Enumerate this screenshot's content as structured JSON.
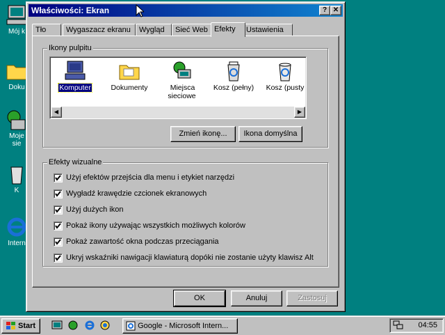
{
  "desktop": {
    "icons": [
      {
        "label": "Mój k",
        "icon": "computer-icon"
      },
      {
        "label": "Doku",
        "icon": "folder-icon"
      },
      {
        "label": "Moje",
        "label2": "sie",
        "icon": "network-icon"
      },
      {
        "label": "K",
        "icon": "recycle-bin-icon"
      },
      {
        "label": "Intern",
        "icon": "internet-explorer-icon"
      }
    ]
  },
  "window": {
    "title": "Właściwości: Ekran",
    "help_button": "?",
    "close_button": "✕"
  },
  "tabs": [
    {
      "label": "Tło"
    },
    {
      "label": "Wygaszacz ekranu"
    },
    {
      "label": "Wygląd"
    },
    {
      "label": "Sieć Web"
    },
    {
      "label": "Efekty",
      "active": true
    },
    {
      "label": "Ustawienia"
    }
  ],
  "desktop_icons_group": {
    "legend": "Ikony pulpitu",
    "items": [
      {
        "label": "Komputer",
        "icon": "computer-icon",
        "selected": true
      },
      {
        "label": "Dokumenty",
        "icon": "folder-icon"
      },
      {
        "label": "Miejsca sieciowe",
        "icon": "network-places-icon"
      },
      {
        "label": "Kosz (pełny)",
        "icon": "recycle-bin-full-icon"
      },
      {
        "label": "Kosz (pusty",
        "icon": "recycle-bin-empty-icon"
      }
    ],
    "change_icon_button": "Zmień ikonę...",
    "default_icon_button": "Ikona domyślna"
  },
  "visual_effects_group": {
    "legend": "Efekty wizualne",
    "options": [
      {
        "label": "Użyj efektów przejścia dla menu i etykiet narzędzi",
        "checked": true
      },
      {
        "label": "Wygładź krawędzie czcionek ekranowych",
        "checked": true
      },
      {
        "label": "Użyj dużych ikon",
        "checked": true
      },
      {
        "label": "Pokaż ikony używając wszystkich możliwych kolorów",
        "checked": true
      },
      {
        "label": "Pokaż zawartość okna podczas przeciągania",
        "checked": true
      },
      {
        "label": "Ukryj wskaźniki nawigacji klawiaturą dopóki nie zostanie użyty klawisz Alt",
        "checked": true
      }
    ]
  },
  "dialog_buttons": {
    "ok": "OK",
    "cancel": "Anuluj",
    "apply": "Zastosuj"
  },
  "taskbar": {
    "start_label": "Start",
    "task_label": "Google - Microsoft Intern...",
    "clock": "04:55"
  },
  "colors": {
    "desktop": "#008080",
    "title_bar": "#000080",
    "selection": "#000080"
  }
}
